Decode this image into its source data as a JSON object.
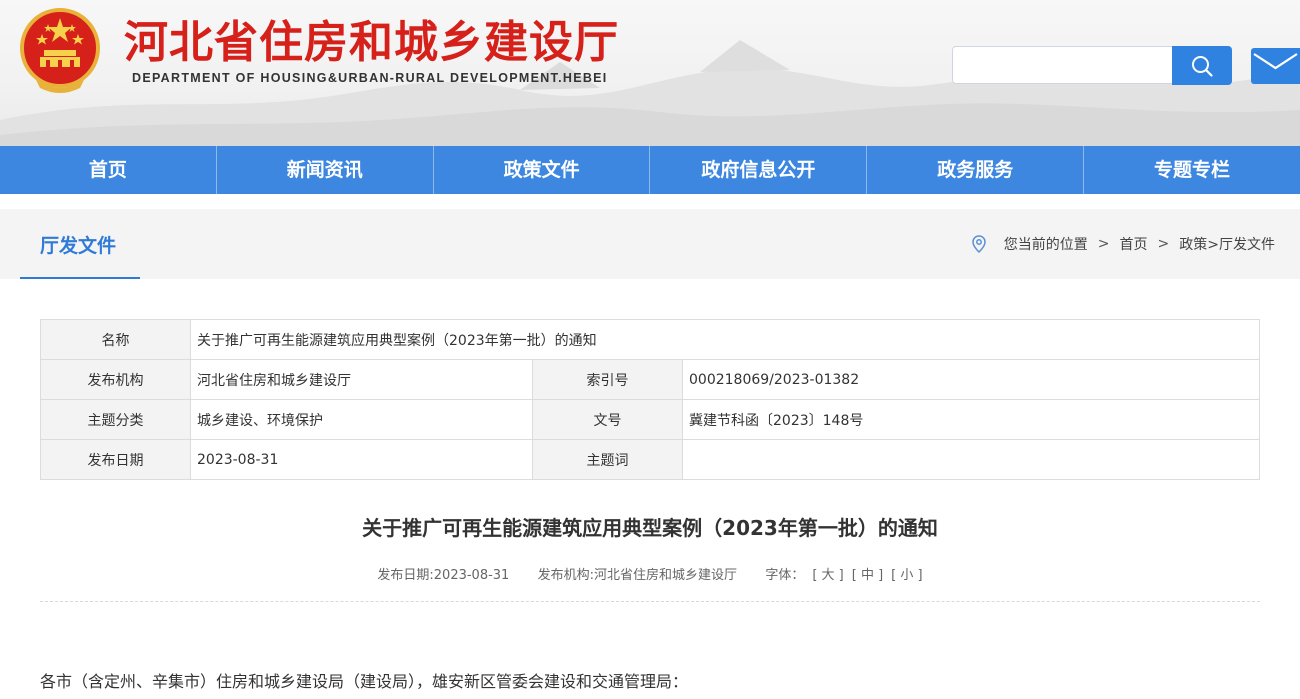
{
  "header": {
    "site_title": "河北省住房和城乡建设厅",
    "site_subtitle": "DEPARTMENT OF HOUSING&URBAN-RURAL DEVELOPMENT.HEBEI",
    "search_placeholder": "",
    "search_icon": "search-icon",
    "mail_icon": "mail-icon",
    "emblem_icon": "national-emblem-icon"
  },
  "nav": {
    "items": [
      "首页",
      "新闻资讯",
      "政策文件",
      "政府信息公开",
      "政务服务",
      "专题专栏"
    ]
  },
  "section": {
    "title": "厅发文件",
    "breadcrumb": {
      "prefix": "您当前的位置",
      "sep": ">",
      "home": "首页",
      "current": "政策>厅发文件"
    }
  },
  "info": {
    "name_label": "名称",
    "name_value": "关于推广可再生能源建筑应用典型案例（2023年第一批）的通知",
    "issuer_label": "发布机构",
    "issuer_value": "河北省住房和城乡建设厅",
    "index_label": "索引号",
    "index_value": "000218069/2023-01382",
    "topic_label": "主题分类",
    "topic_value": "城乡建设、环境保护",
    "docno_label": "文号",
    "docno_value": "冀建节科函〔2023〕148号",
    "date_label": "发布日期",
    "date_value": "2023-08-31",
    "keywords_label": "主题词",
    "keywords_value": ""
  },
  "article": {
    "title": "关于推广可再生能源建筑应用典型案例（2023年第一批）的通知",
    "meta": {
      "date_label": "发布日期:",
      "date_value": "2023-08-31",
      "issuer_label": "发布机构:",
      "issuer_value": "河北省住房和城乡建设厅",
      "font_label": "字体：",
      "font_large": "[ 大 ]",
      "font_medium": "[ 中 ]",
      "font_small": "[ 小 ]"
    },
    "first_line": "各市（含定州、辛集市）住房和城乡建设局（建设局），雄安新区管委会建设和交通管理局："
  },
  "colors": {
    "brand_red": "#d6201a",
    "nav_blue": "#3d87e0",
    "accent_blue": "#2f7ad6",
    "button_blue": "#2f82e0"
  }
}
